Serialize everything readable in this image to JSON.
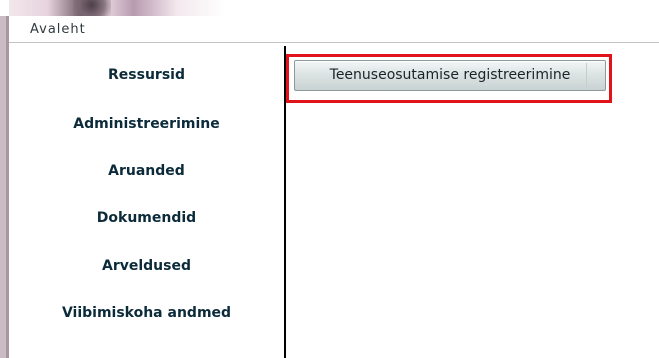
{
  "breadcrumb": {
    "label": "Avaleht"
  },
  "sidebar": {
    "items": [
      {
        "label": "Ressursid"
      },
      {
        "label": "Administreerimine"
      },
      {
        "label": "Aruanded"
      },
      {
        "label": "Dokumendid"
      },
      {
        "label": "Arveldused"
      },
      {
        "label": "Viibimiskoha andmed"
      }
    ]
  },
  "main": {
    "action_button_label": "Teenuseosutamise registreerimine"
  },
  "colors": {
    "highlight_border": "#e0131b",
    "sidebar_text": "#0c2b3a",
    "divider": "#000000"
  }
}
